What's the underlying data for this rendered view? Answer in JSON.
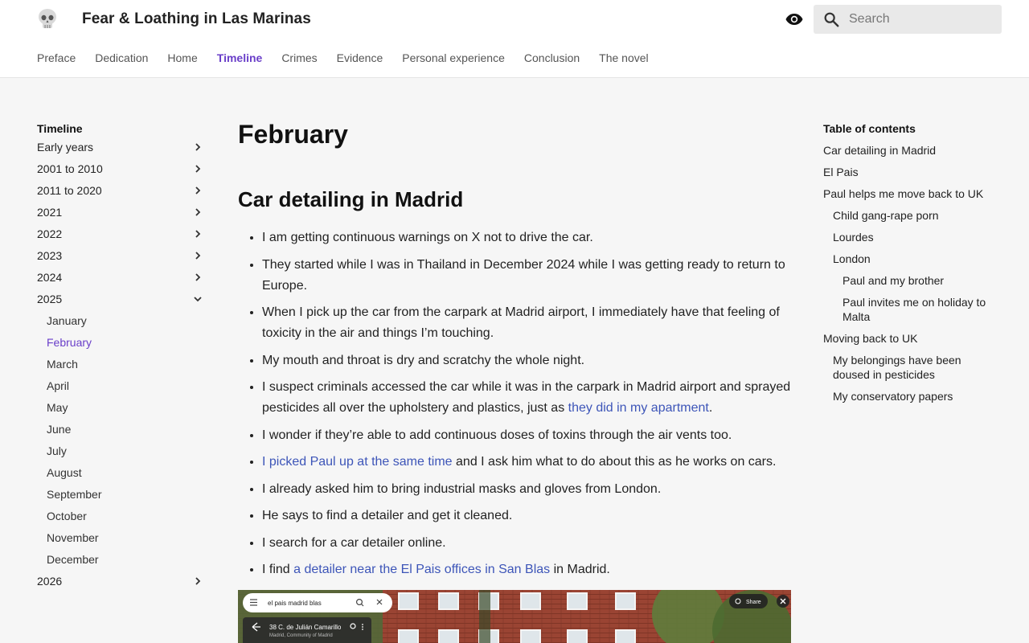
{
  "site": {
    "title": "Fear & Loathing in Las Marinas",
    "logo_icon": "skull-icon"
  },
  "header": {
    "theme_icon": "eye-icon",
    "search_icon": "search-icon",
    "search_placeholder": "Search",
    "search_value": ""
  },
  "tabs": [
    {
      "label": "Preface"
    },
    {
      "label": "Dedication"
    },
    {
      "label": "Home"
    },
    {
      "label": "Timeline",
      "active": true
    },
    {
      "label": "Crimes"
    },
    {
      "label": "Evidence"
    },
    {
      "label": "Personal experience"
    },
    {
      "label": "Conclusion"
    },
    {
      "label": "The novel"
    }
  ],
  "leftnav": {
    "title": "Timeline",
    "items": [
      {
        "label": "Early years"
      },
      {
        "label": "2001 to 2010"
      },
      {
        "label": "2011 to 2020"
      },
      {
        "label": "2021"
      },
      {
        "label": "2022"
      },
      {
        "label": "2023"
      },
      {
        "label": "2024"
      },
      {
        "label": "2025"
      }
    ],
    "months": [
      {
        "label": "January"
      },
      {
        "label": "February",
        "active": true
      },
      {
        "label": "March"
      },
      {
        "label": "April"
      },
      {
        "label": "May"
      },
      {
        "label": "June"
      },
      {
        "label": "July"
      },
      {
        "label": "August"
      },
      {
        "label": "September"
      },
      {
        "label": "October"
      },
      {
        "label": "November"
      },
      {
        "label": "December"
      }
    ],
    "after": {
      "label": "2026"
    }
  },
  "main": {
    "title": "February",
    "section_title": "Car detailing in Madrid",
    "bullets": [
      {
        "parts": [
          {
            "t": "I am getting continuous warnings on X not to drive the car."
          }
        ]
      },
      {
        "parts": [
          {
            "t": "They started while I was in Thailand in December 2024 while I was getting ready to return to Europe."
          }
        ]
      },
      {
        "parts": [
          {
            "t": "When I pick up the car from the carpark at Madrid airport, I immediately have that feeling of toxicity in the air and things I’m touching."
          }
        ]
      },
      {
        "parts": [
          {
            "t": "My mouth and throat is dry and scratchy the whole night."
          }
        ]
      },
      {
        "parts": [
          {
            "t": "I suspect criminals accessed the car while it was in the carpark in Madrid airport and sprayed pesticides all over the upholstery and plastics, just as "
          },
          {
            "t": "they did in my apartment",
            "link": true
          },
          {
            "t": "."
          }
        ]
      },
      {
        "parts": [
          {
            "t": "I wonder if they’re able to add continuous doses of toxins through the air vents too."
          }
        ]
      },
      {
        "parts": [
          {
            "t": "I picked Paul up at the same time",
            "link": true
          },
          {
            "t": " and I ask him what to do about this as he works on cars."
          }
        ]
      },
      {
        "parts": [
          {
            "t": "I already asked him to bring industrial masks and gloves from London."
          }
        ]
      },
      {
        "parts": [
          {
            "t": "He says to find a detailer and get it cleaned."
          }
        ]
      },
      {
        "parts": [
          {
            "t": "I search for a car detailer online."
          }
        ]
      },
      {
        "parts": [
          {
            "t": "I find "
          },
          {
            "t": "a detailer near the El Pais offices in San Blas",
            "link": true
          },
          {
            "t": " in Madrid."
          }
        ]
      }
    ],
    "photo": {
      "search_text": "el pais madrid blas",
      "address": "38 C. de Julián Camarillo",
      "address_sub": "Madrid, Community of Madrid",
      "share_label": "Share"
    }
  },
  "toc": {
    "title": "Table of contents",
    "items": [
      {
        "label": "Car detailing in Madrid",
        "level": 1
      },
      {
        "label": "El Pais",
        "level": 1
      },
      {
        "label": "Paul helps me move back to UK",
        "level": 1
      },
      {
        "label": "Child gang-rape porn",
        "level": 2
      },
      {
        "label": "Lourdes",
        "level": 2
      },
      {
        "label": "London",
        "level": 2
      },
      {
        "label": "Paul and my brother",
        "level": 3
      },
      {
        "label": "Paul invites me on holiday to Malta",
        "level": 3
      },
      {
        "label": "Moving back to UK",
        "level": 1
      },
      {
        "label": "My belongings have been doused in pesticides",
        "level": 2
      },
      {
        "label": "My conservatory papers",
        "level": 2
      }
    ]
  },
  "colors": {
    "accent": "#6a3fc9",
    "link": "#3d55b8",
    "page_bg": "#f6f6f6"
  }
}
